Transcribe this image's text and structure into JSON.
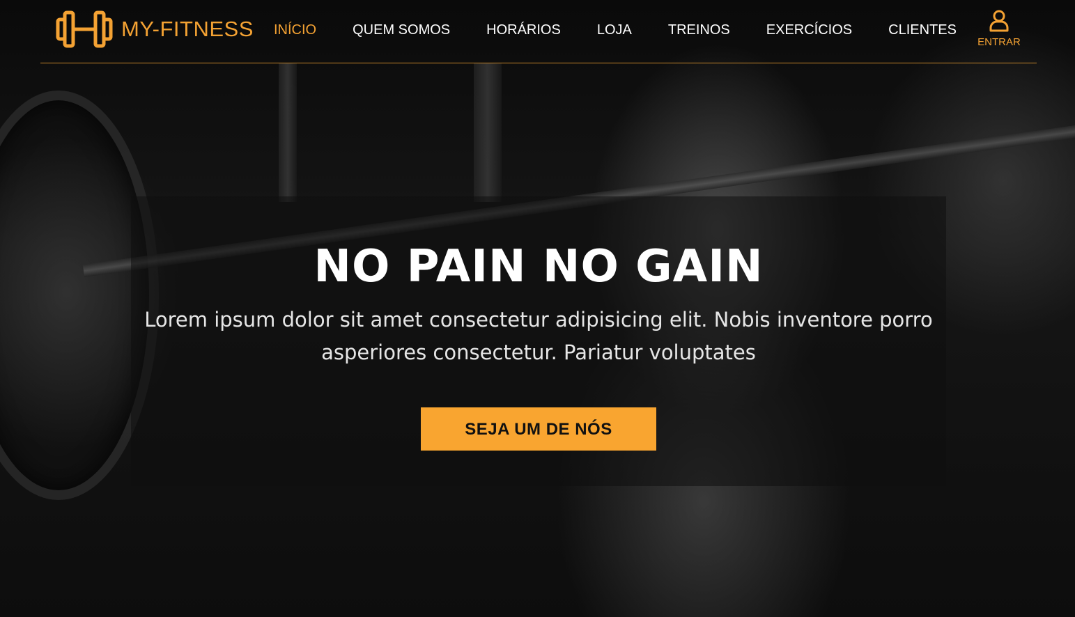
{
  "brand": {
    "name": "MY-FITNESS",
    "icon": "dumbbell-icon"
  },
  "nav": {
    "items": [
      {
        "label": "INÍCIO",
        "active": true
      },
      {
        "label": "QUEM SOMOS",
        "active": false
      },
      {
        "label": "HORÁRIOS",
        "active": false
      },
      {
        "label": "LOJA",
        "active": false
      },
      {
        "label": "TREINOS",
        "active": false
      },
      {
        "label": "EXERCÍCIOS",
        "active": false
      },
      {
        "label": "CLIENTES",
        "active": false
      }
    ],
    "login": {
      "label": "ENTRAR",
      "icon": "user-icon"
    }
  },
  "hero": {
    "title": "NO PAIN NO GAIN",
    "text": "Lorem ipsum dolor sit amet consectetur adipisicing elit. Nobis inventore porro asperiores consectetur. Pariatur voluptates",
    "cta_label": "SEJA UM DE NÓS"
  },
  "colors": {
    "accent": "#f4a233",
    "button": "#f9a530",
    "text": "#ffffff",
    "background": "#000000"
  }
}
